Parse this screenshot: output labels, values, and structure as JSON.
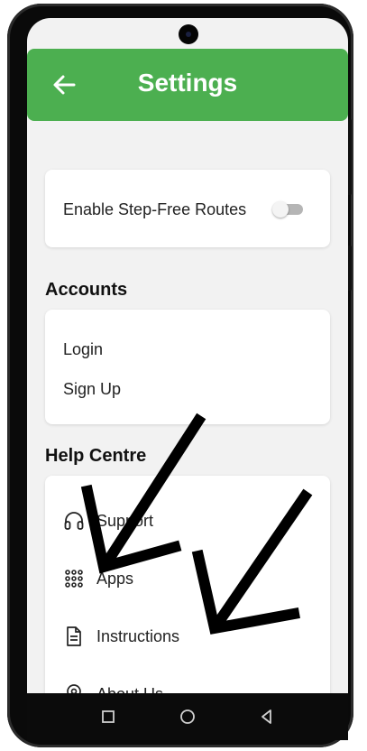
{
  "app_bar": {
    "title": "Settings",
    "color": "#4caf50",
    "back_icon": "arrow-left-icon"
  },
  "preferences": {
    "step_free_label": "Enable Step-Free Routes",
    "step_free_enabled": false
  },
  "accounts": {
    "heading": "Accounts",
    "items": [
      {
        "label": "Login"
      },
      {
        "label": "Sign Up"
      }
    ]
  },
  "help_centre": {
    "heading": "Help Centre",
    "items": [
      {
        "label": "Support",
        "icon": "headphones-icon"
      },
      {
        "label": "Apps",
        "icon": "apps-grid-icon"
      },
      {
        "label": "Instructions",
        "icon": "document-icon"
      },
      {
        "label": "About Us",
        "icon": "location-pin-icon"
      }
    ]
  },
  "annotations": {
    "arrow_color": "#000000",
    "arrow_count": 2
  },
  "system_nav": {
    "buttons": [
      "recents-icon",
      "home-icon",
      "back-icon"
    ]
  }
}
